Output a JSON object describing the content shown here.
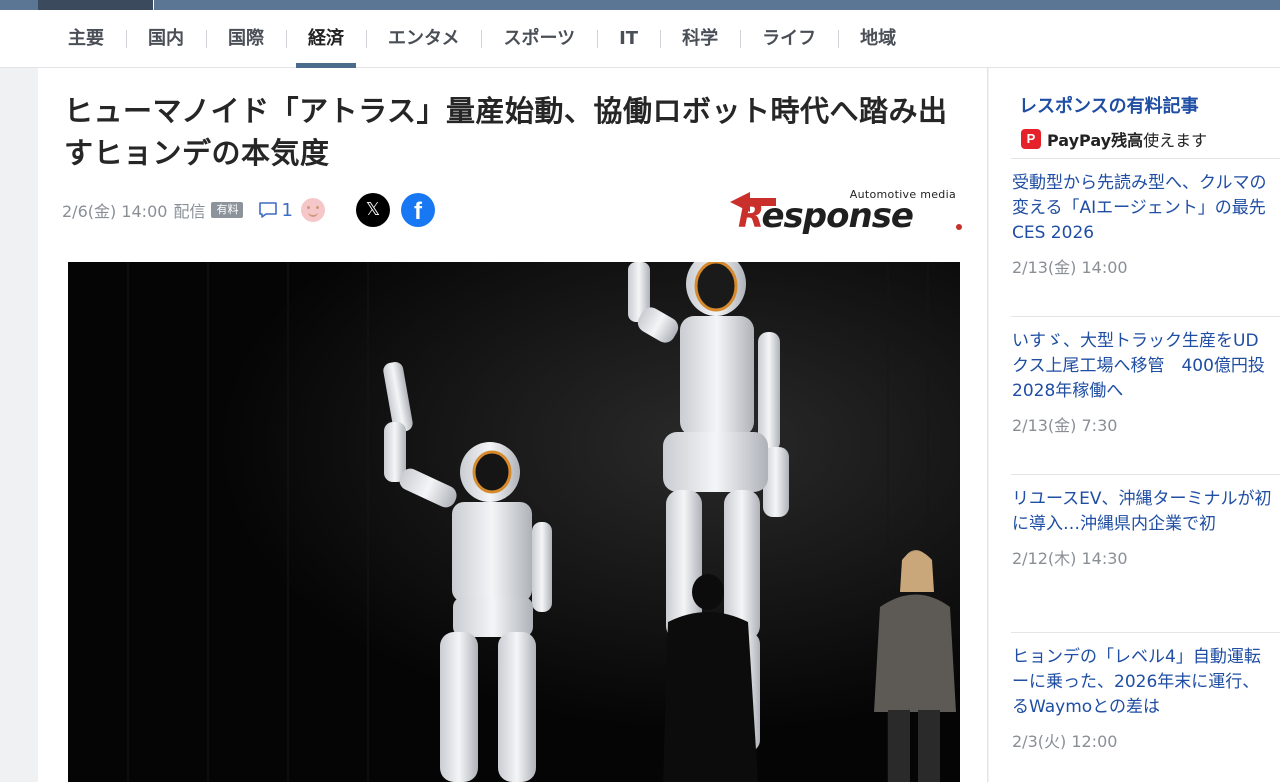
{
  "nav": {
    "items": [
      "主要",
      "国内",
      "国際",
      "経済",
      "エンタメ",
      "スポーツ",
      "IT",
      "科学",
      "ライフ",
      "地域"
    ],
    "active": "経済"
  },
  "article": {
    "title": "ヒューマノイド「アトラス」量産始動、協働ロボット時代へ踏み出すヒョンデの本気度",
    "date": "2/6(金) 14:00",
    "delivered": "配信",
    "paid_badge": "有料",
    "comment_count": "1",
    "source_logo": {
      "tagline": "Automotive media",
      "wordmark_r": "R",
      "wordmark_rest": "esponse"
    }
  },
  "sidebar": {
    "heading": "レスポンスの有料記事",
    "paypay": {
      "icon": "P",
      "brand": "PayPay残高",
      "text": "使えます"
    },
    "items": [
      {
        "lines": [
          "受動型から先読み型へ、クルマの",
          "変える「AIエージェント」の最先",
          "CES 2026"
        ],
        "date": "2/13(金) 14:00"
      },
      {
        "lines": [
          "いすゞ、大型トラック生産をUD",
          "クス上尾工場へ移管　400億円投",
          "2028年稼働へ"
        ],
        "date": "2/13(金) 7:30"
      },
      {
        "lines": [
          "リユースEV、沖縄ターミナルが初",
          "に導入…沖縄県内企業で初"
        ],
        "date": "2/12(木) 14:30"
      },
      {
        "lines": [
          "ヒョンデの「レベル4」自動運転",
          "ーに乗った、2026年末に運行、",
          "るWaymoとの差は"
        ],
        "date": "2/3(火) 12:00"
      }
    ]
  },
  "colors": {
    "accent_blue": "#1f4ea3",
    "nav_active_bar": "#4b6b8c",
    "paypay_red": "#e5222a",
    "facebook_blue": "#1877f2"
  }
}
